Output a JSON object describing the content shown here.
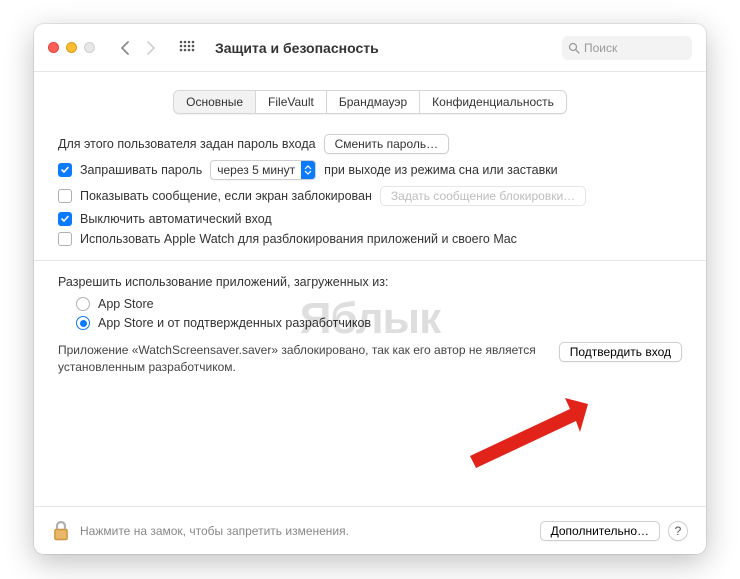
{
  "window": {
    "title": "Защита и безопасность",
    "search_placeholder": "Поиск"
  },
  "tabs": {
    "general": "Основные",
    "filevault": "FileVault",
    "firewall": "Брандмауэр",
    "privacy": "Конфиденциальность"
  },
  "general": {
    "password_set_label": "Для этого пользователя задан пароль входа",
    "change_password_btn": "Сменить пароль…",
    "require_password_label": "Запрашивать пароль",
    "require_password_delay": "через 5 минут",
    "require_password_suffix": "при выходе из режима сна или заставки",
    "show_message_label": "Показывать сообщение, если экран заблокирован",
    "set_lock_message_btn": "Задать сообщение блокировки…",
    "disable_autologin_label": "Выключить автоматический вход",
    "apple_watch_label": "Использовать Apple Watch для разблокирования приложений и своего Mac"
  },
  "allow_from": {
    "section": "Разрешить использование приложений, загруженных из:",
    "app_store": "App Store",
    "app_store_identified": "App Store и от подтвержденных разработчиков"
  },
  "blocked": {
    "message": "Приложение «WatchScreensaver.saver» заблокировано, так как его автор не является установленным разработчиком.",
    "open_anyway_btn": "Подтвердить вход"
  },
  "footer": {
    "lock_text": "Нажмите на замок, чтобы запретить изменения.",
    "advanced_btn": "Дополнительно…"
  },
  "watermark": "Яблык"
}
